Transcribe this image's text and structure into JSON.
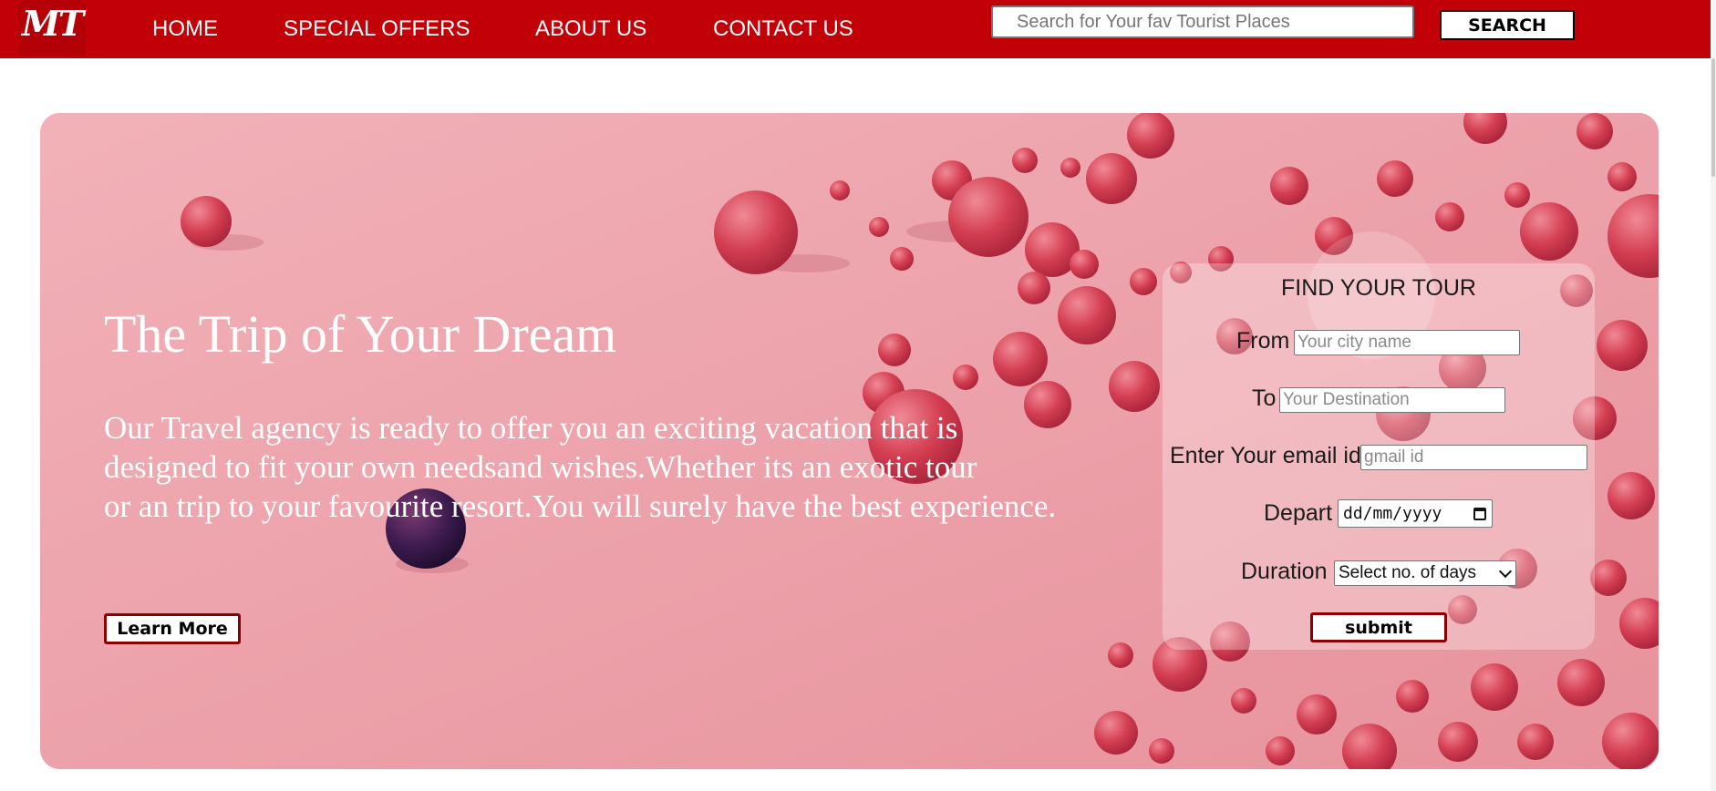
{
  "logo": {
    "text": "MT"
  },
  "nav": {
    "home": "HOME",
    "special_offers": "SPECIAL OFFERS",
    "about_us": "ABOUT US",
    "contact_us": "CONTACT US"
  },
  "search": {
    "placeholder": "Search for Your fav Tourist Places",
    "button_label": "SEARCH"
  },
  "hero": {
    "title": "The Trip of Your Dream",
    "text_lines": [
      "Our Travel agency is ready to offer you an exciting vacation that is",
      "designed to fit your own needsand wishes.Whether its an exotic tour",
      "or an trip to your favourite resort.You will surely have the best experience."
    ],
    "learn_more_label": "Learn More"
  },
  "tour_form": {
    "title": "FIND YOUR TOUR",
    "from_label": "From",
    "from_placeholder": "Your city name",
    "to_label": "To",
    "to_placeholder": "Your Destination",
    "email_label": "Enter Your email id",
    "email_placeholder": "gmail id",
    "depart_label": "Depart",
    "depart_value": "dd/mm/yyyy",
    "duration_label": "Duration",
    "duration_selected": "Select no. of days",
    "submit_label": "submit"
  },
  "colors": {
    "nav_background": "#c20007",
    "hero_background": "#eea6ae",
    "button_border": "#8b0000",
    "balloon": "#cf3a4d"
  },
  "icons": {
    "date_picker": "calendar-icon",
    "duration_dropdown": "chevron-down-icon"
  }
}
